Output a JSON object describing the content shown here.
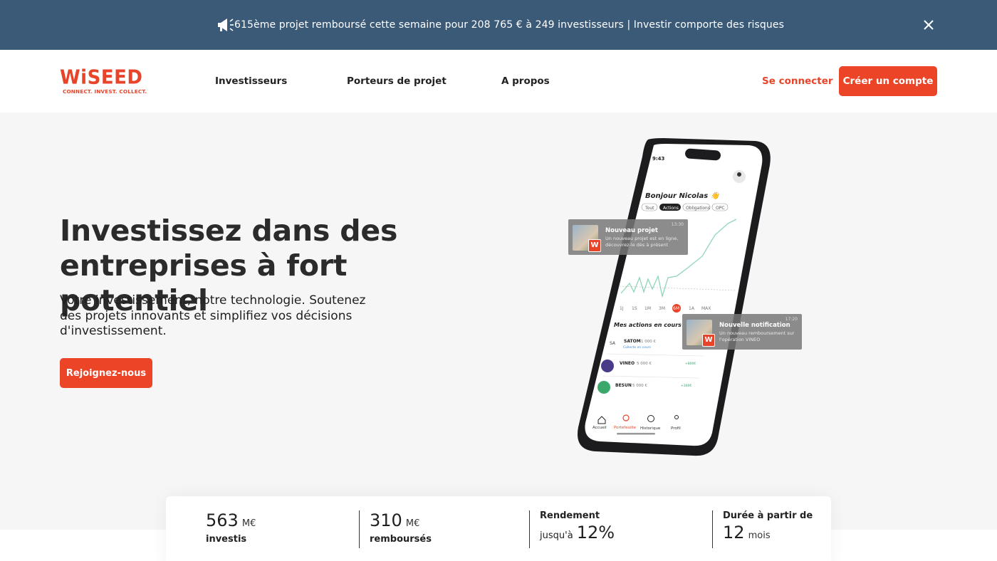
{
  "announcement": {
    "text": "615ème projet remboursé cette semaine pour 208 765 € à 249 investisseurs | Investir comporte des risques",
    "icon": "megaphone-icon",
    "close_icon": "close-icon"
  },
  "header": {
    "logo_word": "WiSEED",
    "logo_tagline": "CONNECT. INVEST. COLLECT.",
    "nav": [
      "Investisseurs",
      "Porteurs de projet",
      "A propos"
    ],
    "login_label": "Se connecter",
    "signup_label": "Créer un compte"
  },
  "hero": {
    "title_line1": "Investissez dans des",
    "title_line2": "entreprises à fort potentiel",
    "subtitle": "Votre investissement, notre technologie. Soutenez des projets innovants et simplifiez vos décisions d'investissement.",
    "cta_label": "Rejoignez-nous"
  },
  "phone": {
    "time": "9:43",
    "greeting": "Bonjour Nicolas 👋",
    "filters": [
      "Tout",
      "Actions",
      "Obligations",
      "OPC"
    ],
    "ranges": [
      "1J",
      "1S",
      "1M",
      "3M",
      "6M",
      "1A",
      "MAX"
    ],
    "section_title": "Mes actions en cours",
    "holdings": [
      {
        "name": "SATOM",
        "amount": "1 000 €",
        "sub": "Collecte en cours"
      },
      {
        "name": "VINEO",
        "amount": "5 000 €",
        "sub": "",
        "delta": "+800€"
      },
      {
        "name": "BESUN",
        "amount": "5 000 €",
        "sub": "",
        "delta": "+300€"
      }
    ],
    "tabs": [
      "Accueil",
      "Portefeuille",
      "Historique",
      "Profil"
    ],
    "notifications": [
      {
        "title": "Nouveau projet",
        "text": "Un nouveau projet est en ligne, découvrez-le dès à présent",
        "time": "13:30",
        "badge": "W"
      },
      {
        "title": "Nouvelle notification",
        "text": "Un nouveau remboursement sur l'opération VINEO",
        "time": "17:20",
        "badge": "W"
      }
    ]
  },
  "stats": [
    {
      "value": "563",
      "unit": "M€",
      "label": "investis"
    },
    {
      "value": "310",
      "unit": "M€",
      "label": "remboursés"
    },
    {
      "heading": "Rendement",
      "prefix": "jusqu'à",
      "value": "12%"
    },
    {
      "heading": "Durée à partir de",
      "value": "12",
      "unit": "mois"
    }
  ],
  "colors": {
    "brand": "#e8442a",
    "announce_bg": "#3b5a78",
    "page_bg": "#f6f6f6"
  }
}
